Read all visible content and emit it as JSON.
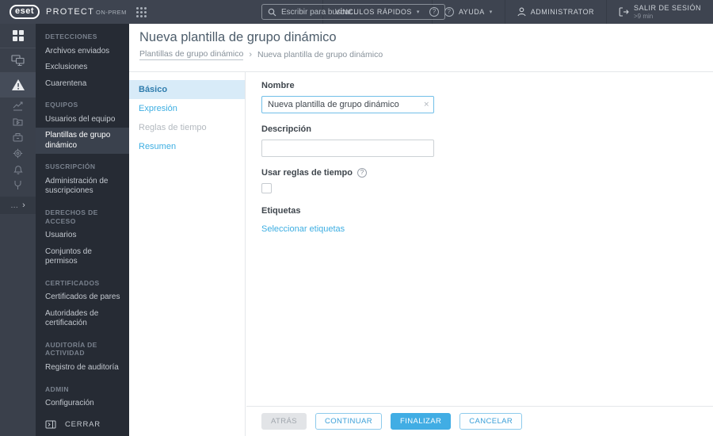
{
  "topbar": {
    "brand": "eset",
    "product": "PROTECT",
    "edition": "ON-PREM",
    "search_placeholder": "Escribir para buscar...",
    "quick_links_label": "VÍNCULOS RÁPIDOS",
    "help_label": "AYUDA",
    "user_label": "ADMINISTRATOR",
    "logout_label": "SALIR DE SESIÓN",
    "logout_timeout": ">9 min"
  },
  "sidebar": {
    "sections": [
      {
        "header": "DETECCIONES",
        "items": [
          "Archivos enviados",
          "Exclusiones",
          "Cuarentena"
        ]
      },
      {
        "header": "EQUIPOS",
        "items": [
          "Usuarios del equipo",
          "Plantillas de grupo dinámico"
        ]
      },
      {
        "header": "SUSCRIPCIÓN",
        "items": [
          "Administración de suscripciones"
        ]
      },
      {
        "header": "DERECHOS DE ACCESO",
        "items": [
          "Usuarios",
          "Conjuntos de permisos"
        ]
      },
      {
        "header": "CERTIFICADOS",
        "items": [
          "Certificados de pares",
          "Autoridades de certificación"
        ]
      },
      {
        "header": "AUDITORÍA DE ACTIVIDAD",
        "items": [
          "Registro de auditoría"
        ]
      },
      {
        "header": "ADMIN",
        "items": [
          "Configuración"
        ]
      }
    ],
    "selected_item": "Plantillas de grupo dinámico",
    "collapse_label": "CERRAR"
  },
  "page": {
    "title": "Nueva plantilla de grupo dinámico",
    "breadcrumb_parent": "Plantillas de grupo dinámico",
    "breadcrumb_current": "Nueva plantilla de grupo dinámico"
  },
  "wizard": {
    "steps": [
      "Básico",
      "Expresión",
      "Reglas de tiempo",
      "Resumen"
    ]
  },
  "form": {
    "name_label": "Nombre",
    "name_value": "Nueva plantilla de grupo dinámico",
    "description_label": "Descripción",
    "description_value": "",
    "time_rules_label": "Usar reglas de tiempo",
    "time_rules_checked": false,
    "tags_label": "Etiquetas",
    "tags_link": "Seleccionar etiquetas"
  },
  "footer": {
    "back": "ATRÁS",
    "continue": "CONTINUAR",
    "finish": "FINALIZAR",
    "cancel": "CANCELAR"
  },
  "icons": {
    "help_glyph": "?",
    "chevron_down": "▾",
    "chevron_right": "›",
    "breadcrumb_sep": "›",
    "close_glyph": "✕",
    "more_glyph": "…"
  },
  "colors": {
    "accent": "#41ade4",
    "topbar_bg": "#3e4450",
    "rail_bg": "#3a404b",
    "sidebar_bg": "#262b34",
    "active_step_bg": "#d8ebf8"
  }
}
